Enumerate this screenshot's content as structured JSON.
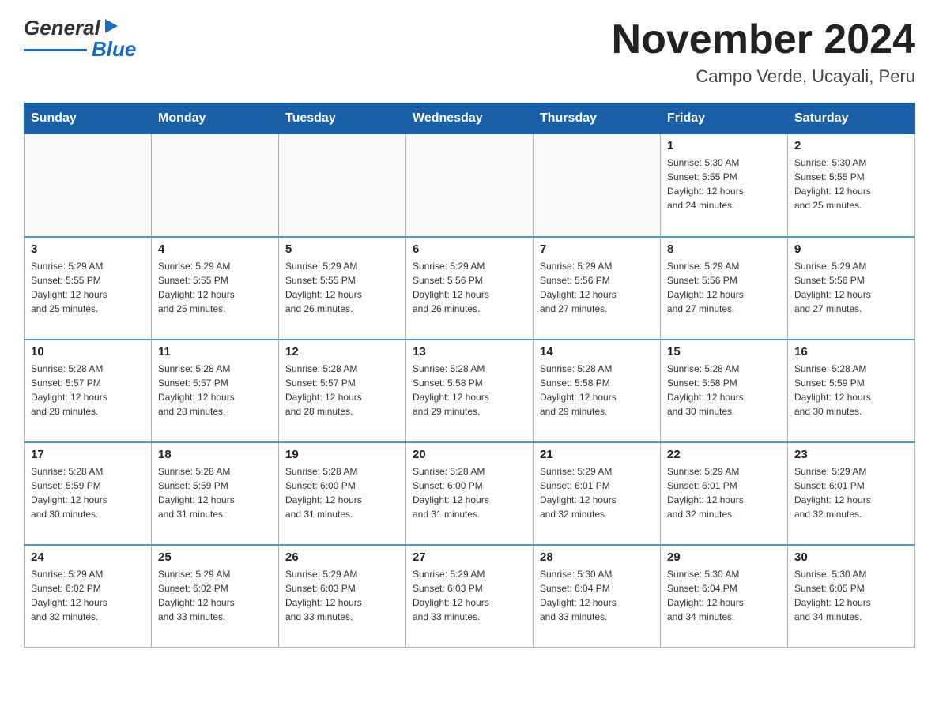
{
  "header": {
    "logo_general": "General",
    "logo_blue": "Blue",
    "month_title": "November 2024",
    "subtitle": "Campo Verde, Ucayali, Peru"
  },
  "days_of_week": [
    "Sunday",
    "Monday",
    "Tuesday",
    "Wednesday",
    "Thursday",
    "Friday",
    "Saturday"
  ],
  "weeks": [
    {
      "cells": [
        {
          "day": "",
          "info": ""
        },
        {
          "day": "",
          "info": ""
        },
        {
          "day": "",
          "info": ""
        },
        {
          "day": "",
          "info": ""
        },
        {
          "day": "",
          "info": ""
        },
        {
          "day": "1",
          "info": "Sunrise: 5:30 AM\nSunset: 5:55 PM\nDaylight: 12 hours\nand 24 minutes."
        },
        {
          "day": "2",
          "info": "Sunrise: 5:30 AM\nSunset: 5:55 PM\nDaylight: 12 hours\nand 25 minutes."
        }
      ]
    },
    {
      "cells": [
        {
          "day": "3",
          "info": "Sunrise: 5:29 AM\nSunset: 5:55 PM\nDaylight: 12 hours\nand 25 minutes."
        },
        {
          "day": "4",
          "info": "Sunrise: 5:29 AM\nSunset: 5:55 PM\nDaylight: 12 hours\nand 25 minutes."
        },
        {
          "day": "5",
          "info": "Sunrise: 5:29 AM\nSunset: 5:55 PM\nDaylight: 12 hours\nand 26 minutes."
        },
        {
          "day": "6",
          "info": "Sunrise: 5:29 AM\nSunset: 5:56 PM\nDaylight: 12 hours\nand 26 minutes."
        },
        {
          "day": "7",
          "info": "Sunrise: 5:29 AM\nSunset: 5:56 PM\nDaylight: 12 hours\nand 27 minutes."
        },
        {
          "day": "8",
          "info": "Sunrise: 5:29 AM\nSunset: 5:56 PM\nDaylight: 12 hours\nand 27 minutes."
        },
        {
          "day": "9",
          "info": "Sunrise: 5:29 AM\nSunset: 5:56 PM\nDaylight: 12 hours\nand 27 minutes."
        }
      ]
    },
    {
      "cells": [
        {
          "day": "10",
          "info": "Sunrise: 5:28 AM\nSunset: 5:57 PM\nDaylight: 12 hours\nand 28 minutes."
        },
        {
          "day": "11",
          "info": "Sunrise: 5:28 AM\nSunset: 5:57 PM\nDaylight: 12 hours\nand 28 minutes."
        },
        {
          "day": "12",
          "info": "Sunrise: 5:28 AM\nSunset: 5:57 PM\nDaylight: 12 hours\nand 28 minutes."
        },
        {
          "day": "13",
          "info": "Sunrise: 5:28 AM\nSunset: 5:58 PM\nDaylight: 12 hours\nand 29 minutes."
        },
        {
          "day": "14",
          "info": "Sunrise: 5:28 AM\nSunset: 5:58 PM\nDaylight: 12 hours\nand 29 minutes."
        },
        {
          "day": "15",
          "info": "Sunrise: 5:28 AM\nSunset: 5:58 PM\nDaylight: 12 hours\nand 30 minutes."
        },
        {
          "day": "16",
          "info": "Sunrise: 5:28 AM\nSunset: 5:59 PM\nDaylight: 12 hours\nand 30 minutes."
        }
      ]
    },
    {
      "cells": [
        {
          "day": "17",
          "info": "Sunrise: 5:28 AM\nSunset: 5:59 PM\nDaylight: 12 hours\nand 30 minutes."
        },
        {
          "day": "18",
          "info": "Sunrise: 5:28 AM\nSunset: 5:59 PM\nDaylight: 12 hours\nand 31 minutes."
        },
        {
          "day": "19",
          "info": "Sunrise: 5:28 AM\nSunset: 6:00 PM\nDaylight: 12 hours\nand 31 minutes."
        },
        {
          "day": "20",
          "info": "Sunrise: 5:28 AM\nSunset: 6:00 PM\nDaylight: 12 hours\nand 31 minutes."
        },
        {
          "day": "21",
          "info": "Sunrise: 5:29 AM\nSunset: 6:01 PM\nDaylight: 12 hours\nand 32 minutes."
        },
        {
          "day": "22",
          "info": "Sunrise: 5:29 AM\nSunset: 6:01 PM\nDaylight: 12 hours\nand 32 minutes."
        },
        {
          "day": "23",
          "info": "Sunrise: 5:29 AM\nSunset: 6:01 PM\nDaylight: 12 hours\nand 32 minutes."
        }
      ]
    },
    {
      "cells": [
        {
          "day": "24",
          "info": "Sunrise: 5:29 AM\nSunset: 6:02 PM\nDaylight: 12 hours\nand 32 minutes."
        },
        {
          "day": "25",
          "info": "Sunrise: 5:29 AM\nSunset: 6:02 PM\nDaylight: 12 hours\nand 33 minutes."
        },
        {
          "day": "26",
          "info": "Sunrise: 5:29 AM\nSunset: 6:03 PM\nDaylight: 12 hours\nand 33 minutes."
        },
        {
          "day": "27",
          "info": "Sunrise: 5:29 AM\nSunset: 6:03 PM\nDaylight: 12 hours\nand 33 minutes."
        },
        {
          "day": "28",
          "info": "Sunrise: 5:30 AM\nSunset: 6:04 PM\nDaylight: 12 hours\nand 33 minutes."
        },
        {
          "day": "29",
          "info": "Sunrise: 5:30 AM\nSunset: 6:04 PM\nDaylight: 12 hours\nand 34 minutes."
        },
        {
          "day": "30",
          "info": "Sunrise: 5:30 AM\nSunset: 6:05 PM\nDaylight: 12 hours\nand 34 minutes."
        }
      ]
    }
  ]
}
